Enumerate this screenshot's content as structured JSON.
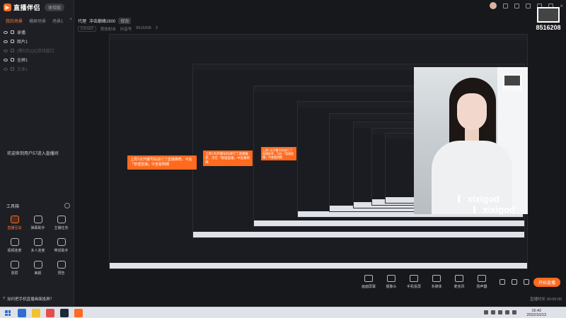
{
  "app": {
    "name": "直播伴侣",
    "badge": "体验版"
  },
  "scene_tabs": [
    {
      "label": "我的场景",
      "active": true
    },
    {
      "label": "横屏场景",
      "active": false
    },
    {
      "label": "场景1",
      "active": false
    }
  ],
  "scene_tabs_plus": "+",
  "sources": [
    {
      "label": "录播",
      "dim": false
    },
    {
      "label": "图片1",
      "dim": false
    },
    {
      "label": "(第5页)QQ游戏窗口",
      "dim": true
    },
    {
      "label": "全屏1",
      "dim": false
    },
    {
      "label": "文本1",
      "dim": true
    }
  ],
  "welcome_message": "欢迎来到用户57进入直播间",
  "tools": {
    "title": "工具箱",
    "items": [
      {
        "label": "直播互动",
        "hot": true,
        "icon": "interact-icon"
      },
      {
        "label": "弹幕助手",
        "hot": false,
        "icon": "danmaku-icon"
      },
      {
        "label": "主播任务",
        "hot": false,
        "icon": "task-icon"
      },
      {
        "label": "视频连麦",
        "hot": false,
        "icon": "video-link-icon"
      },
      {
        "label": "多人连麦",
        "hot": false,
        "icon": "multi-link-icon"
      },
      {
        "label": "带货助手",
        "hot": false,
        "icon": "shop-icon"
      },
      {
        "label": "录屏",
        "hot": false,
        "icon": "record-icon"
      },
      {
        "label": "美颜",
        "hot": false,
        "icon": "beauty-icon"
      },
      {
        "label": "预告",
        "hot": false,
        "icon": "notice-icon"
      }
    ]
  },
  "topbar": {
    "topic_label": "代理",
    "topic_value": "冲击巅峰2800",
    "topic_tag": "修改",
    "category": "CS:GO",
    "subcategory": "竞技射击",
    "id_label": "抖音号",
    "id_value": "8516208",
    "hot_count": "3"
  },
  "preview": {
    "orange_note": "上周7点开播号码进行了直播推荐，可在「管理直播」中查看明细",
    "watermark_name": "xixigod",
    "stamp_number": "8516208"
  },
  "bottom_tools": [
    {
      "label": "画面屏幕",
      "icon": "screen-icon"
    },
    {
      "label": "摄像头",
      "icon": "camera-icon"
    },
    {
      "label": "手机投屏",
      "icon": "phone-cast-icon"
    },
    {
      "label": "多媒体",
      "icon": "media-icon"
    },
    {
      "label": "麦克风",
      "icon": "mic-icon"
    },
    {
      "label": "扬声器",
      "icon": "speaker-icon"
    }
  ],
  "go_live_label": "开始直播",
  "status": {
    "question": "如何把手机直播画面投屏？",
    "right": [
      "直播时长 00:00:00"
    ]
  },
  "taskbar": {
    "time": "16:42",
    "date": "2022/10/13"
  },
  "colors": {
    "accent": "#ff6a1f",
    "background": "#17181c",
    "panel": "#1e1f24"
  }
}
